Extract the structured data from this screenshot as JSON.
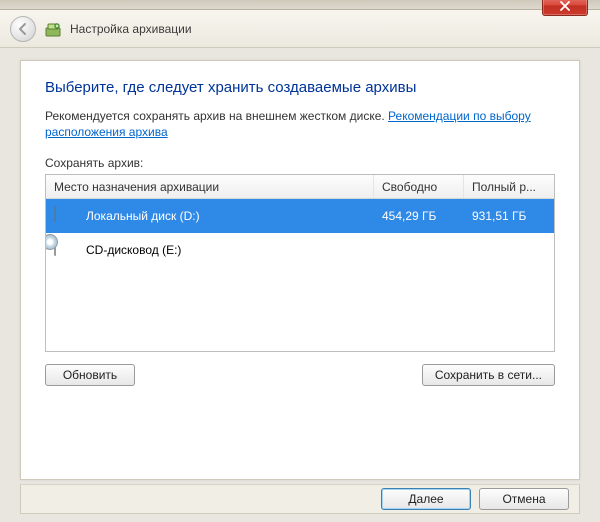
{
  "nav": {
    "title": "Настройка архивации"
  },
  "heading": "Выберите, где следует хранить создаваемые архивы",
  "subtext": {
    "lead": "Рекомендуется сохранять архив на внешнем жестком диске. ",
    "link": "Рекомендации по выбору расположения архива"
  },
  "label": "Сохранять архив:",
  "table": {
    "headers": {
      "dest": "Место назначения архивации",
      "free": "Свободно",
      "size": "Полный р..."
    },
    "rows": [
      {
        "name": "Локальный диск (D:)",
        "free": "454,29 ГБ",
        "size": "931,51 ГБ",
        "icon": "hdd",
        "selected": true
      },
      {
        "name": "CD-дисковод (E:)",
        "free": "",
        "size": "",
        "icon": "cd",
        "selected": false
      }
    ]
  },
  "buttons": {
    "refresh": "Обновить",
    "network": "Сохранить в сети...",
    "next": "Далее",
    "cancel": "Отмена"
  }
}
